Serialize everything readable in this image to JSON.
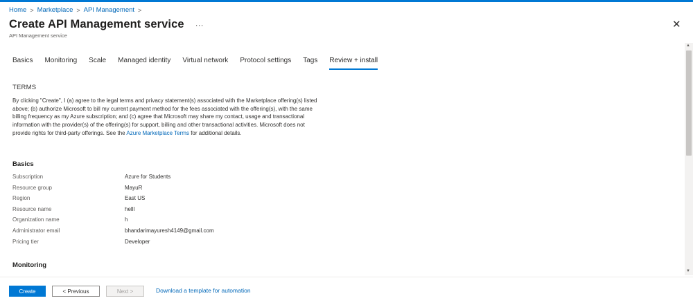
{
  "breadcrumb": {
    "home": "Home",
    "marketplace": "Marketplace",
    "apim": "API Management",
    "sep": ">"
  },
  "header": {
    "title": "Create API Management service",
    "more": "···",
    "subtitle": "API Management service",
    "close": "✕"
  },
  "tabs": [
    {
      "label": "Basics"
    },
    {
      "label": "Monitoring"
    },
    {
      "label": "Scale"
    },
    {
      "label": "Managed identity"
    },
    {
      "label": "Virtual network"
    },
    {
      "label": "Protocol settings"
    },
    {
      "label": "Tags"
    },
    {
      "label": "Review + install"
    }
  ],
  "active_tab": "Review + install",
  "terms": {
    "heading": "TERMS",
    "text_before_link": "By clicking \"Create\", I (a) agree to the legal terms and privacy statement(s) associated with the Marketplace offering(s) listed above; (b) authorize Microsoft to bill my current payment method for the fees associated with the offering(s), with the same billing frequency as my Azure subscription; and (c) agree that Microsoft may share my contact, usage and transactional information with the provider(s) of the offering(s) for support, billing and other transactional activities. Microsoft does not provide rights for third-party offerings. See the",
    "link": "Azure Marketplace Terms",
    "text_after_link": "for additional details."
  },
  "basics": {
    "heading": "Basics",
    "rows": [
      {
        "label": "Subscription",
        "value": "Azure for Students"
      },
      {
        "label": "Resource group",
        "value": "MayuR"
      },
      {
        "label": "Region",
        "value": "East US"
      },
      {
        "label": "Resource name",
        "value": "helll"
      },
      {
        "label": "Organization name",
        "value": "h"
      },
      {
        "label": "Administrator email",
        "value": "bhandarimayuresh4149@gmail.com"
      },
      {
        "label": "Pricing tier",
        "value": "Developer"
      }
    ]
  },
  "monitoring": {
    "heading": "Monitoring"
  },
  "footer": {
    "create": "Create",
    "previous": "< Previous",
    "next": "Next >",
    "download": "Download a template for automation"
  },
  "scrollbar": {
    "up": "▲",
    "down": "▼"
  },
  "colors": {
    "accent": "#0078d4",
    "link": "#0067b8",
    "text": "#323130",
    "muted": "#605e5c"
  }
}
